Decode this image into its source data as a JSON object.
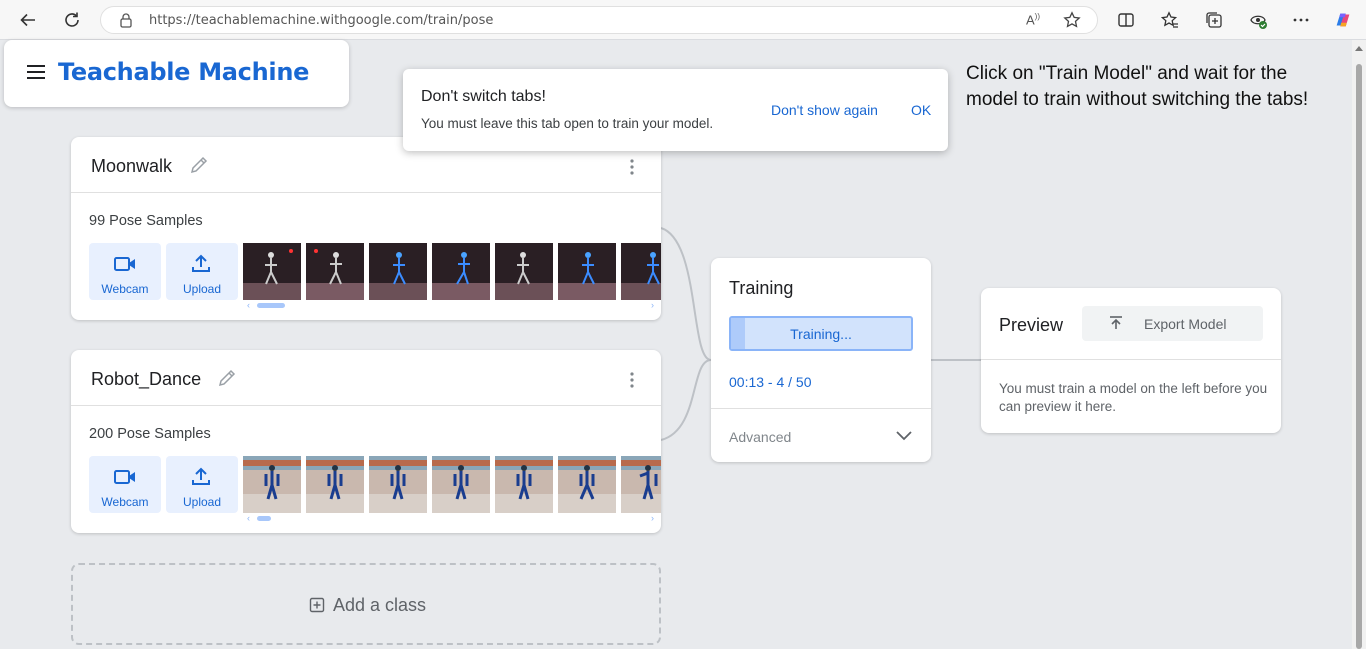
{
  "browser": {
    "url": "https://teachablemachine.withgoogle.com/train/pose",
    "read_aloud_label": "A"
  },
  "app": {
    "title": "Teachable Machine"
  },
  "toast": {
    "title": "Don't switch tabs!",
    "body": "You must leave this tab open to train your model.",
    "dont_show_again": "Don't show again",
    "ok": "OK"
  },
  "instruction": "Click on \"Train Model\" and wait for the model to train without switching the tabs!",
  "classes": [
    {
      "name": "Moonwalk",
      "samples": "99 Pose Samples",
      "webcam_label": "Webcam",
      "upload_label": "Upload"
    },
    {
      "name": "Robot_Dance",
      "samples": "200 Pose Samples",
      "webcam_label": "Webcam",
      "upload_label": "Upload"
    }
  ],
  "add_class": {
    "label": "Add a class"
  },
  "training": {
    "title": "Training",
    "button_label": "Training...",
    "progress_fraction": 0.08,
    "progress_text": "00:13 - 4 / 50",
    "advanced_label": "Advanced"
  },
  "preview": {
    "title": "Preview",
    "export_label": "Export Model",
    "message": "You must train a model on the left before you can preview it here."
  },
  "colors": {
    "brand_blue": "#1967d2",
    "light_blue_bg": "#e8f0fe",
    "page_bg": "#e8eaed"
  },
  "icons": [
    "back-icon",
    "refresh-icon",
    "lock-icon",
    "favorite-star-icon",
    "split-screen-icon",
    "favorites-icon",
    "collections-icon",
    "extensions-icon",
    "more-icon",
    "copilot-icon",
    "menu-icon",
    "pencil-icon",
    "kebab-menu-icon",
    "webcam-icon",
    "upload-icon",
    "add-box-icon",
    "chevron-down-icon",
    "export-upload-icon"
  ]
}
